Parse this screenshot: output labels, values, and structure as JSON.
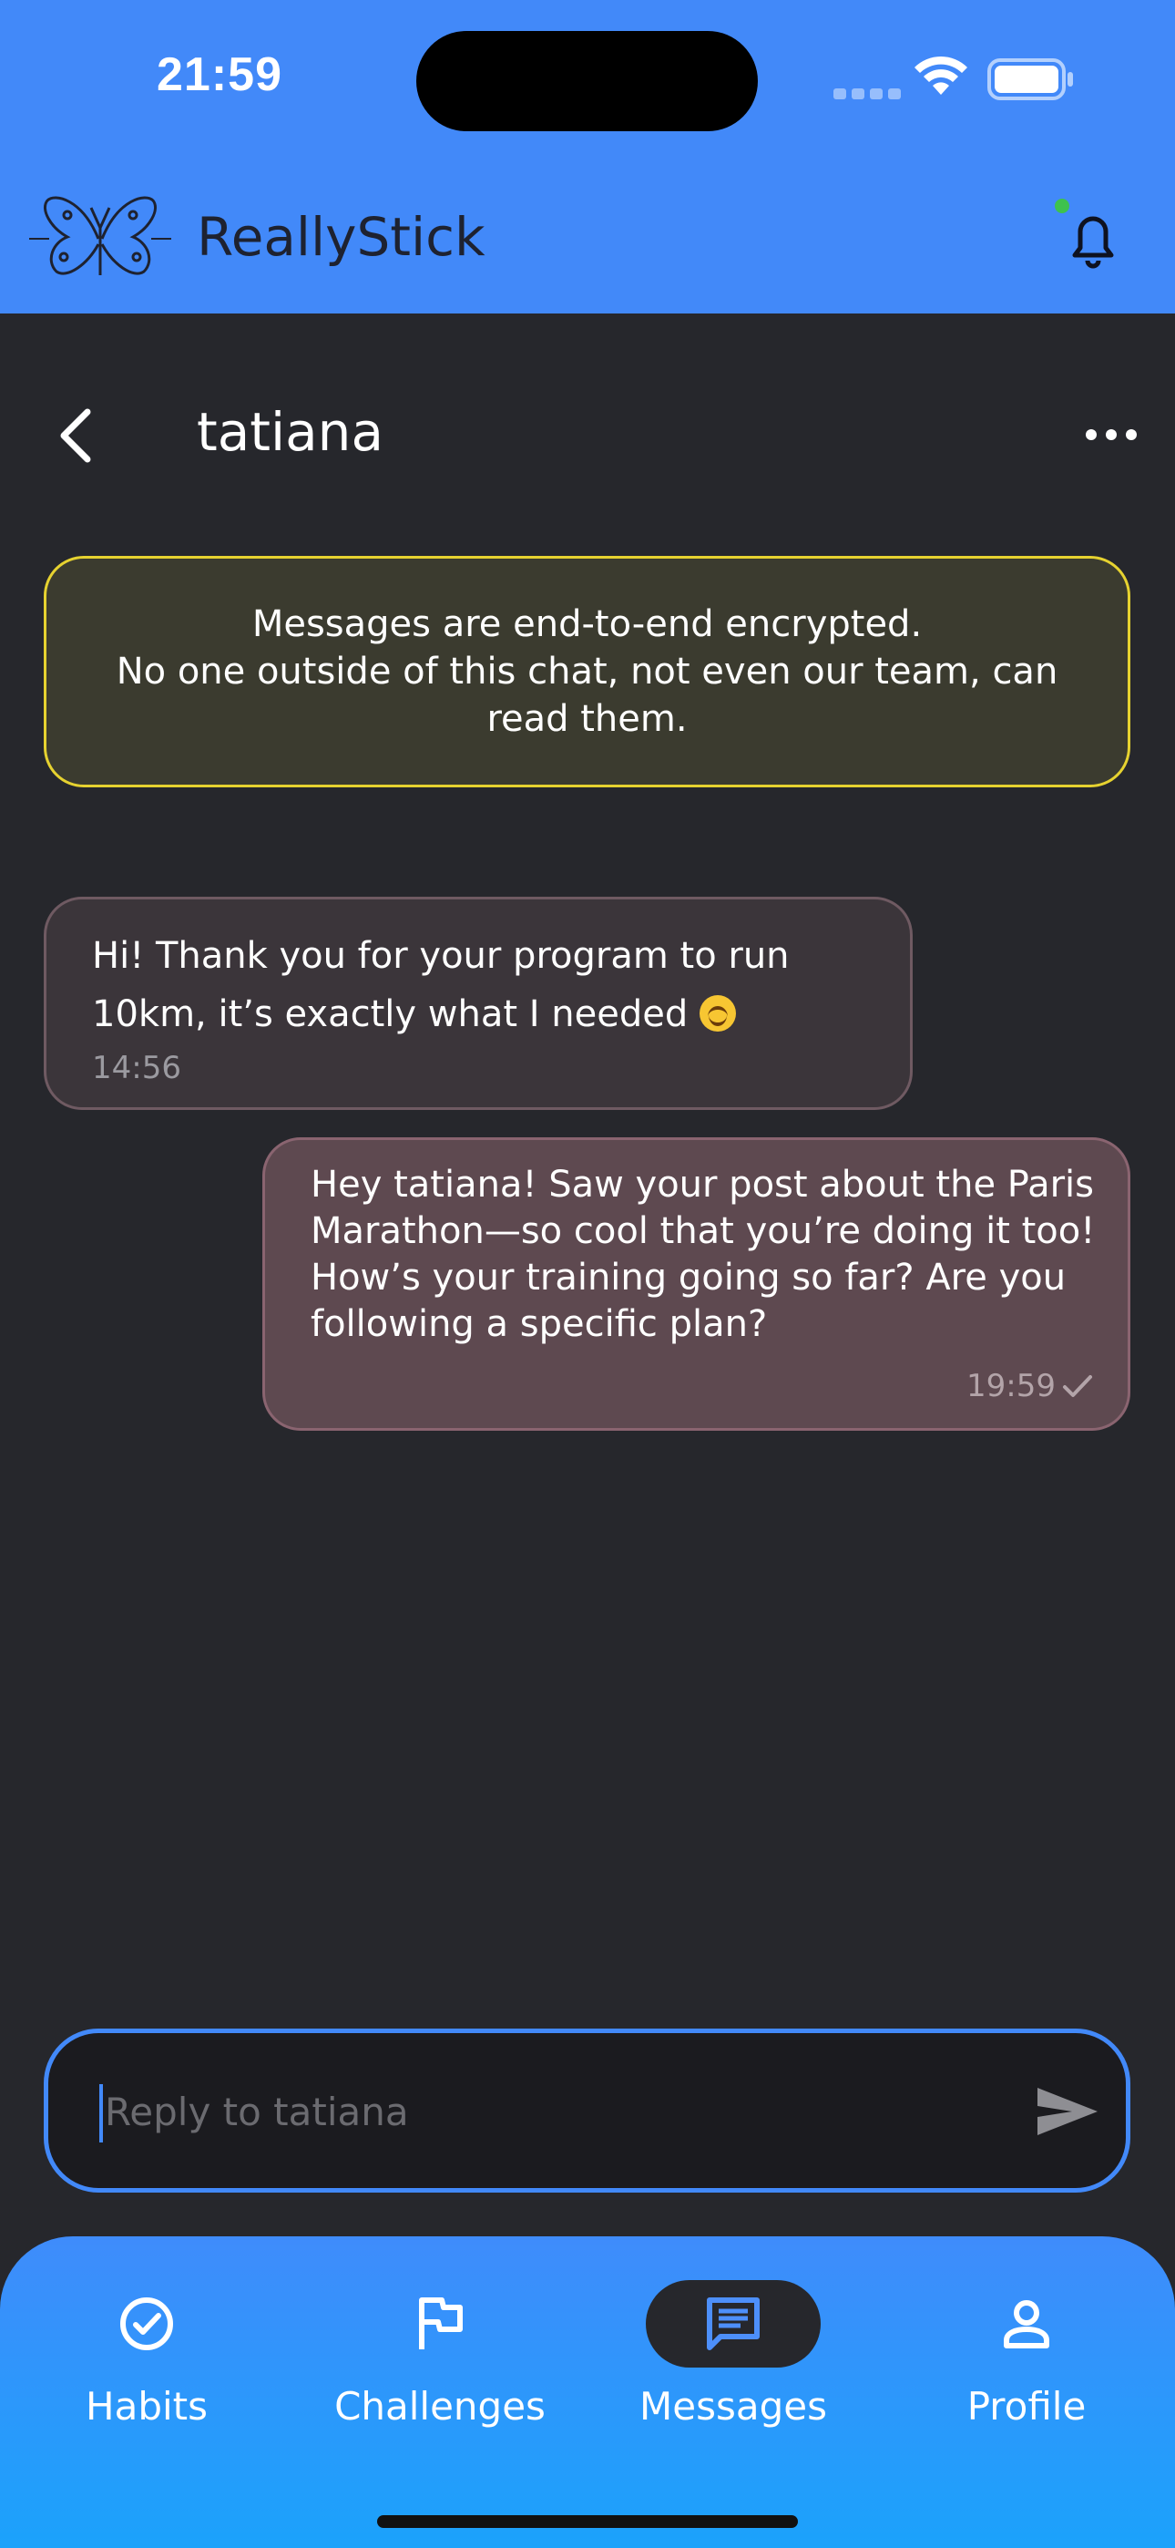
{
  "status_bar": {
    "time": "21:59"
  },
  "app_bar": {
    "title": "ReallyStick"
  },
  "chat": {
    "contact_name": "tatiana",
    "notice": {
      "line1": "Messages are end-to-end encrypted.",
      "line2": "No one outside of this chat, not even our team, can",
      "line3": "read them."
    },
    "messages": [
      {
        "direction": "incoming",
        "text_line1": "Hi! Thank you for your program to run",
        "text_line2": "10km, it’s exactly what I needed",
        "time": "14:56"
      },
      {
        "direction": "outgoing",
        "text": "Hey tatiana! Saw your post about the Paris Marathon—so cool that you’re doing it too! How’s your training going so far? Are you following a specific plan?",
        "time": "19:59"
      }
    ],
    "reply_placeholder": "Reply to tatiana"
  },
  "bottom_nav": {
    "items": [
      {
        "label": "Habits",
        "icon": "check-circle-icon",
        "active": false
      },
      {
        "label": "Challenges",
        "icon": "flag-icon",
        "active": false
      },
      {
        "label": "Messages",
        "icon": "message-icon",
        "active": true
      },
      {
        "label": "Profile",
        "icon": "person-icon",
        "active": false
      }
    ]
  },
  "colors": {
    "brand_blue": "#4289f9",
    "background": "#26272c",
    "notice_border": "#e6d230",
    "incoming_bubble": "#3b353a",
    "outgoing_bubble": "#5e4950",
    "online_dot": "#3ec24d"
  }
}
